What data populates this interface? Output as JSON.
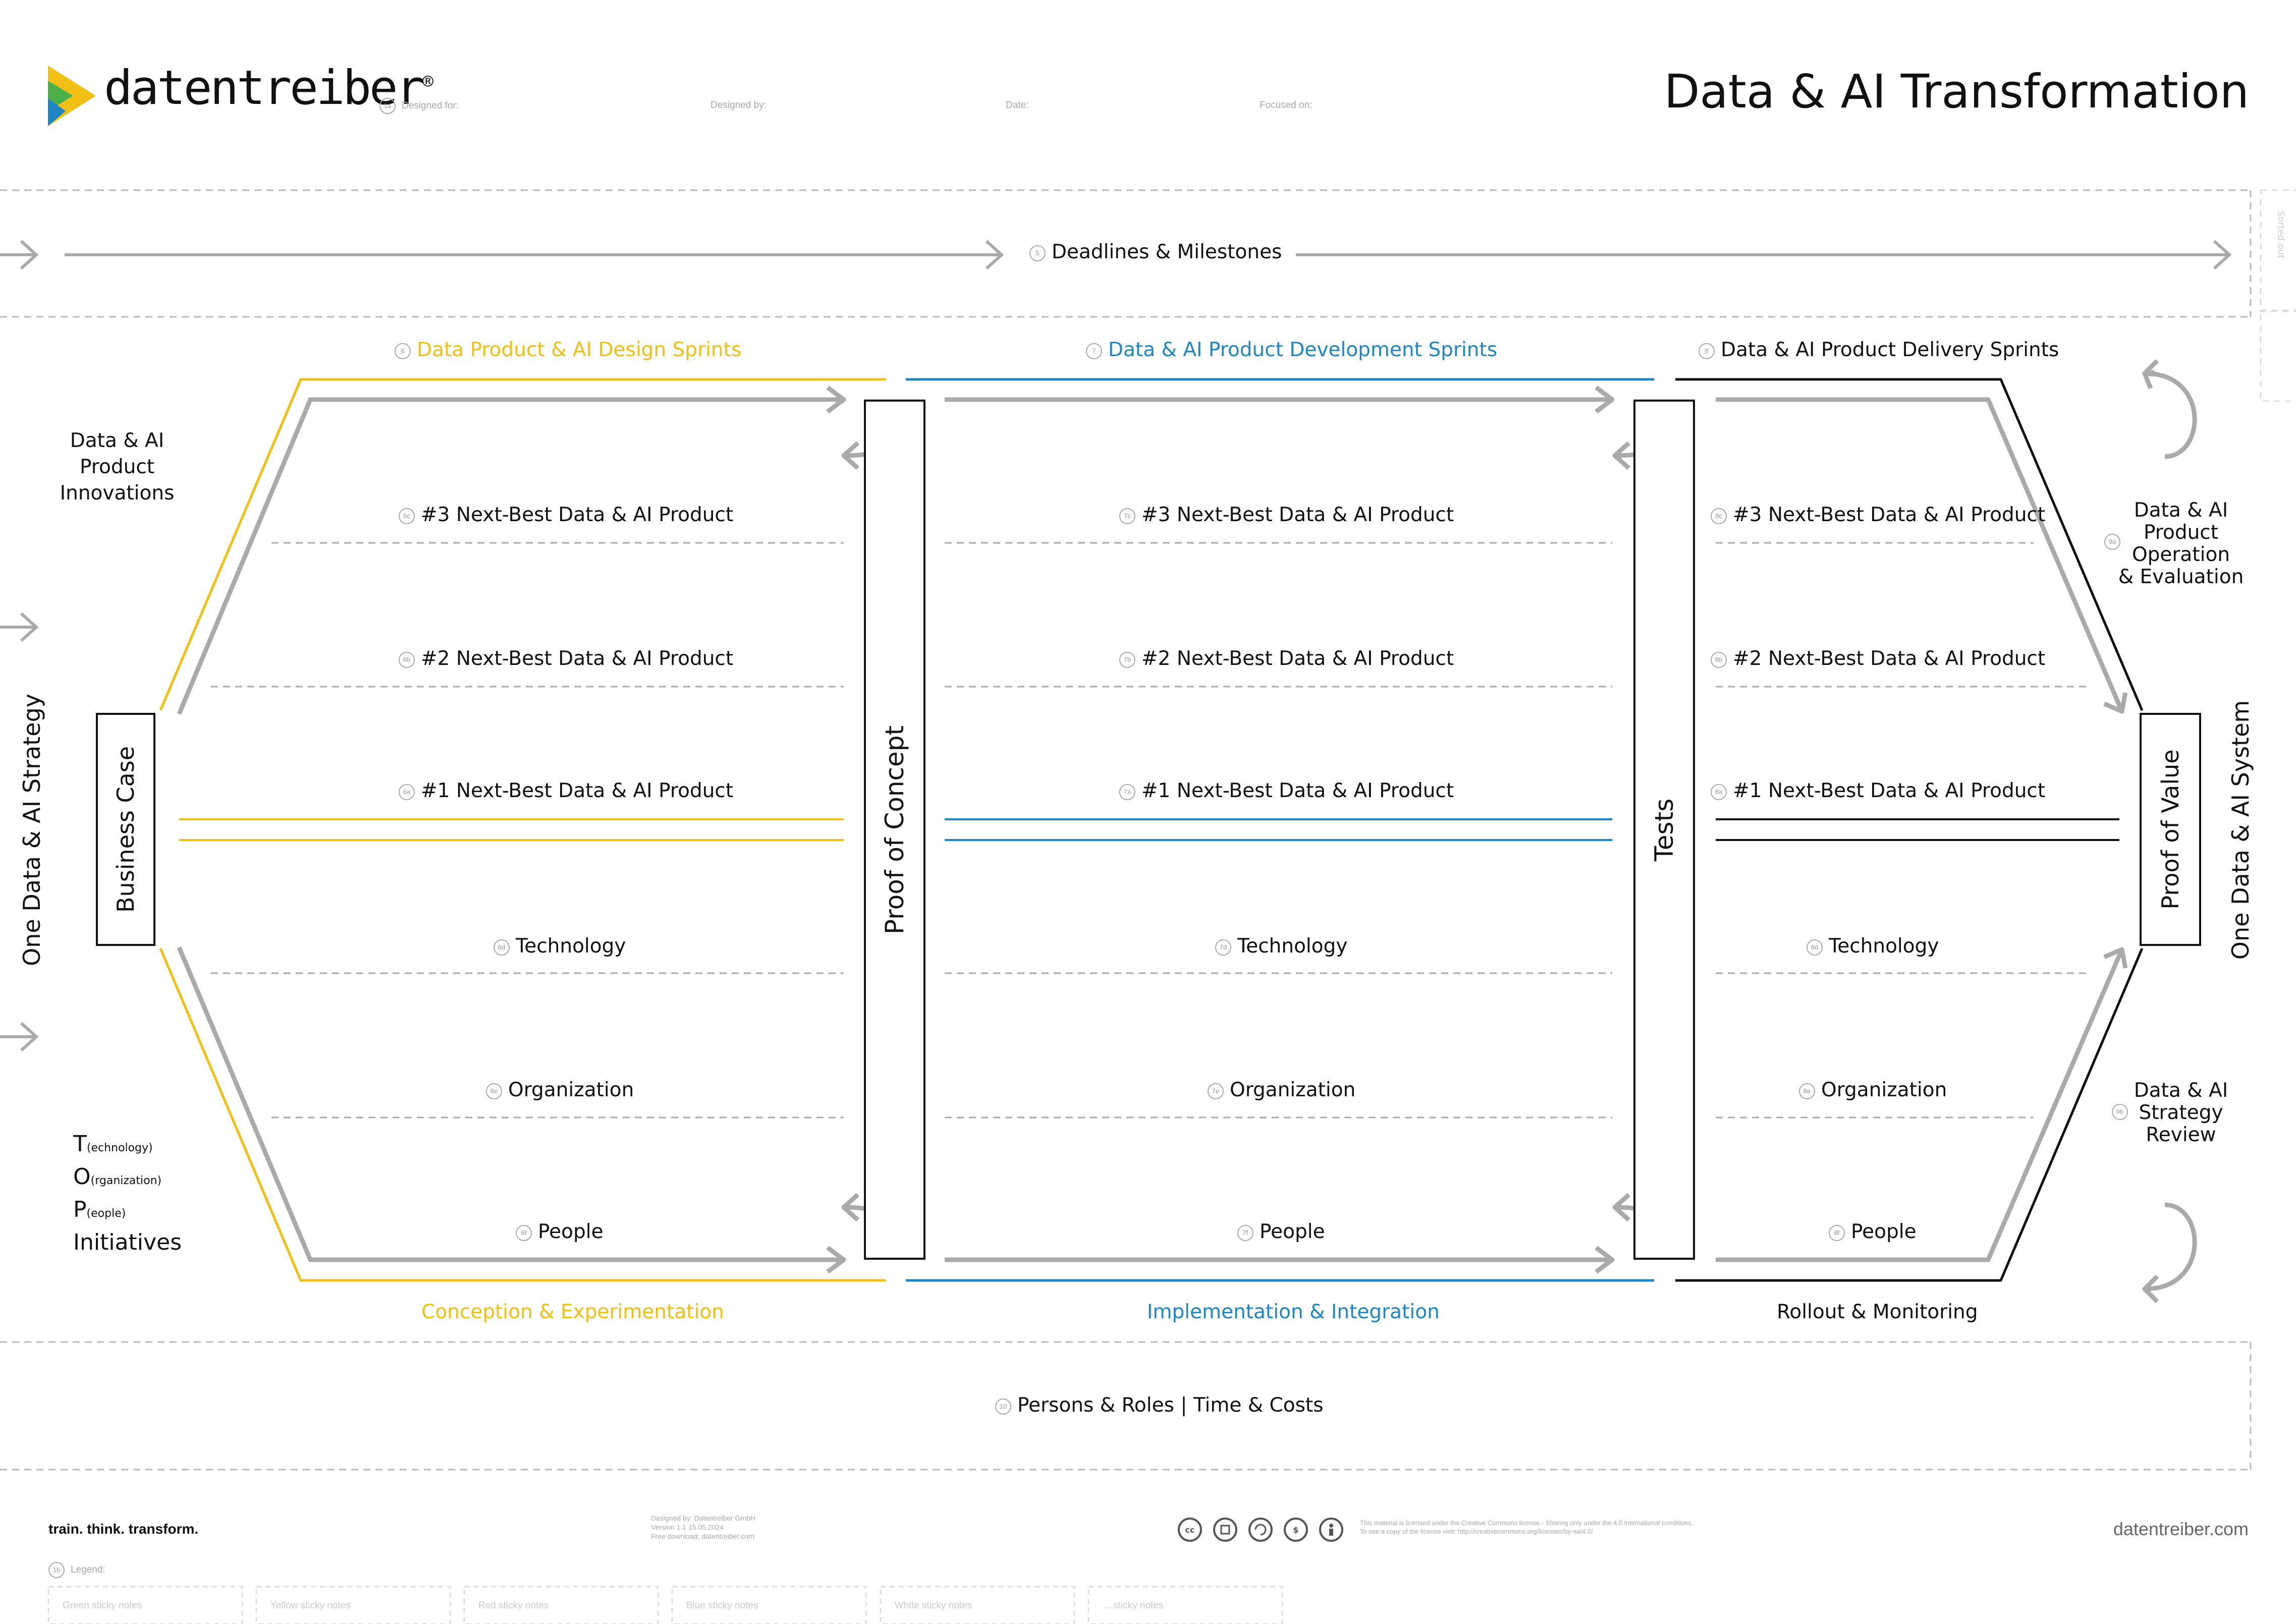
{
  "header": {
    "brand": "datentreiber",
    "brand_mark": "®",
    "title": "Data & AI Transformation",
    "fields": [
      {
        "num": "1a",
        "label": "Designed for:"
      },
      {
        "num": "",
        "label": "Designed by:"
      },
      {
        "num": "",
        "label": "Date:"
      },
      {
        "num": "",
        "label": "Focused on:"
      }
    ]
  },
  "deadlines": {
    "num": "5",
    "label": "Deadlines & Milestones",
    "side_label": "Sorted out"
  },
  "sprints": {
    "design": {
      "num": "6",
      "label": "Data Product & AI Design Sprints",
      "bottom": "Conception & Experimentation"
    },
    "development": {
      "num": "7",
      "label": "Data & AI Product Development Sprints",
      "bottom": "Implementation & Integration"
    },
    "delivery": {
      "num": "8",
      "label": "Data & AI Product Delivery Sprints",
      "bottom": "Rollout & Monitoring"
    }
  },
  "left": {
    "innovations": [
      "Data & AI",
      "Product",
      "Innovations"
    ],
    "strategy": "One Data & AI Strategy",
    "business_case": "Business Case",
    "top_initiatives": [
      {
        "big": "T",
        "small": "(echnology)"
      },
      {
        "big": "O",
        "small": "(rganization)"
      },
      {
        "big": "P",
        "small": "(eople)"
      }
    ],
    "initiatives": "Initiatives"
  },
  "gates": {
    "poc": "Proof of Concept",
    "tests": "Tests",
    "pov": "Proof of Value"
  },
  "right": {
    "system": "One Data & AI System",
    "operation": {
      "num": "9a",
      "lines": [
        "Data & AI",
        "Product",
        "Operation",
        "& Evaluation"
      ]
    },
    "review": {
      "num": "9b",
      "lines": [
        "Data & AI",
        "Strategy",
        "Review"
      ]
    }
  },
  "rows": {
    "col6": [
      {
        "num": "6c",
        "label": "#3 Next-Best Data & AI Product"
      },
      {
        "num": "6b",
        "label": "#2 Next-Best Data & AI Product"
      },
      {
        "num": "6a",
        "label": "#1 Next-Best Data & AI Product"
      },
      {
        "num": "6d",
        "label": "Technology"
      },
      {
        "num": "6e",
        "label": "Organization"
      },
      {
        "num": "6f",
        "label": "People"
      }
    ],
    "col7": [
      {
        "num": "7c",
        "label": "#3 Next-Best Data & AI Product"
      },
      {
        "num": "7b",
        "label": "#2 Next-Best Data & AI Product"
      },
      {
        "num": "7a",
        "label": "#1 Next-Best Data & AI Product"
      },
      {
        "num": "7d",
        "label": "Technology"
      },
      {
        "num": "7e",
        "label": "Organization"
      },
      {
        "num": "7f",
        "label": "People"
      }
    ],
    "col8": [
      {
        "num": "8c",
        "label": "#3 Next-Best Data & AI Product"
      },
      {
        "num": "8b",
        "label": "#2 Next-Best Data & AI Product"
      },
      {
        "num": "8a",
        "label": "#1 Next-Best Data & AI Product"
      },
      {
        "num": "8d",
        "label": "Technology"
      },
      {
        "num": "8e",
        "label": "Organization"
      },
      {
        "num": "8f",
        "label": "People"
      }
    ]
  },
  "persons": {
    "num": "10",
    "label": "Persons & Roles | Time & Costs"
  },
  "footer": {
    "slogan": "train. think. transform.",
    "credits": [
      "Designed by: Datentreiber GmbH",
      "Version 1.1 15.05.2024",
      "Free download: datentreiber.com"
    ],
    "license": [
      "This material is licensed under the Creative Commons license - Sharing only under the 4.0 international conditions.",
      "To see a copy of the license visit: http://creativecommons.org/licenses/by-sa/4.0/"
    ],
    "cc_icons": [
      "cc-icon",
      "by-icon",
      "sa-icon",
      "nc-icon",
      "attribution-icon"
    ],
    "url": "datentreiber.com",
    "legend_num": "1b",
    "legend_label": "Legend:",
    "legend_items": [
      "Green sticky notes",
      "Yellow sticky notes",
      "Red sticky notes",
      "Blue sticky notes",
      "White sticky notes",
      "... sticky notes"
    ]
  },
  "colors": {
    "yellow": "#f2bf15",
    "blue": "#1f86c4",
    "dark": "#111111",
    "gray": "#aaaaaa"
  }
}
